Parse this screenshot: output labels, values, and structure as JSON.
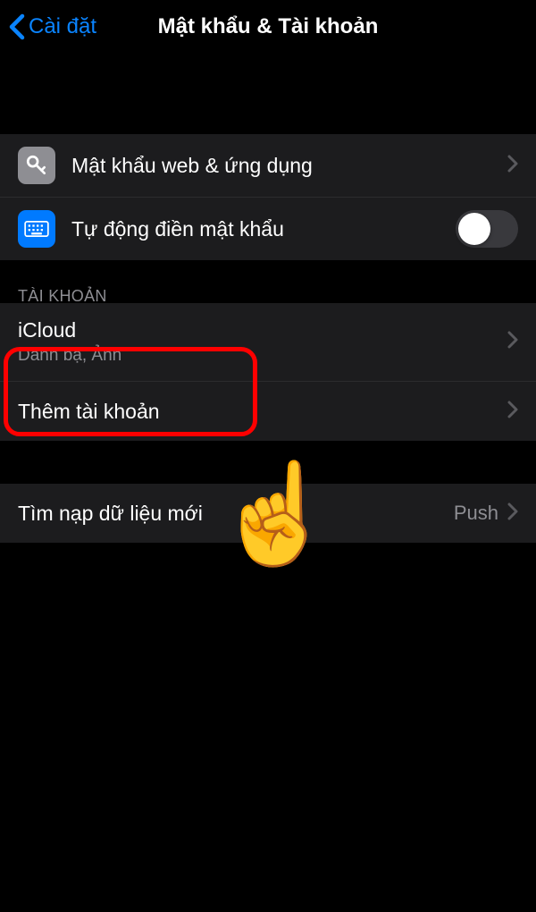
{
  "header": {
    "back_label": "Cài đặt",
    "title": "Mật khẩu & Tài khoản"
  },
  "section1": {
    "web_app_passwords": "Mật khẩu web & ứng dụng",
    "autofill": "Tự động điền mật khẩu"
  },
  "accounts": {
    "header": "TÀI KHOẢN",
    "icloud": {
      "title": "iCloud",
      "subtitle": "Danh bạ, Ảnh"
    },
    "add_account": "Thêm tài khoản"
  },
  "fetch": {
    "label": "Tìm nạp dữ liệu mới",
    "value": "Push"
  }
}
